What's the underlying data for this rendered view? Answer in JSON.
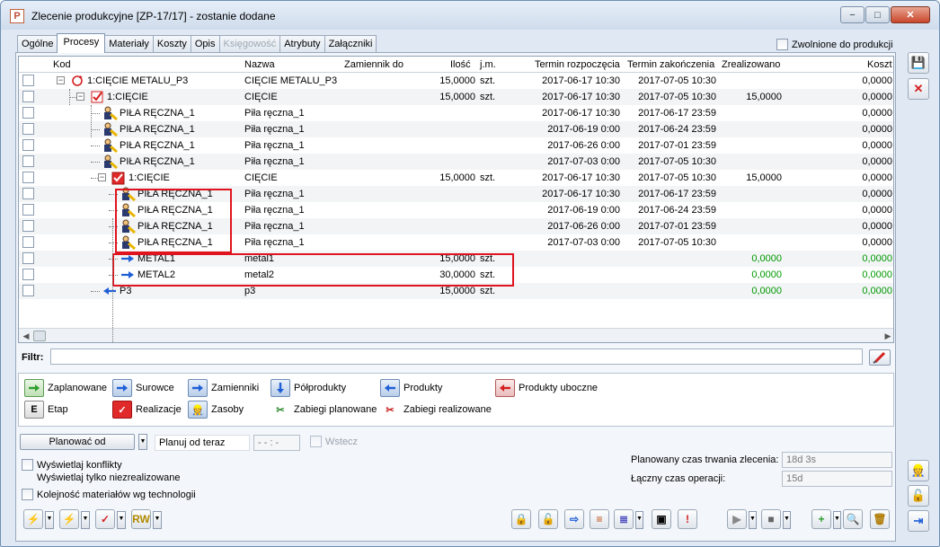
{
  "window": {
    "title": "Zlecenie produkcyjne  [ZP-17/17] - zostanie dodane",
    "app_icon": "P",
    "controls": {
      "minimize": "−",
      "maximize": "□",
      "close": "✕"
    }
  },
  "tabs": [
    {
      "label": "Ogólne",
      "active": false
    },
    {
      "label": "Procesy",
      "active": true
    },
    {
      "label": "Materiały",
      "active": false
    },
    {
      "label": "Koszty",
      "active": false
    },
    {
      "label": "Opis",
      "active": false
    },
    {
      "label": "Księgowość",
      "active": false,
      "disabled": true
    },
    {
      "label": "Atrybuty",
      "active": false
    },
    {
      "label": "Załączniki",
      "active": false
    }
  ],
  "released_label": "Zwolnione do produkcji",
  "columns": {
    "kod": "Kod",
    "nazwa": "Nazwa",
    "zamiennik": "Zamiennik do",
    "ilosc": "Ilość",
    "jm": "j.m.",
    "start": "Termin rozpoczęcia",
    "end": "Termin zakończenia",
    "done": "Zrealizowano",
    "koszt": "Koszt"
  },
  "rows": [
    {
      "kod": "1:CIĘCIE METALU_P3",
      "nazwa": "CIĘCIE METALU_P3",
      "ilosc": "15,0000",
      "jm": "szt.",
      "start": "2017-06-17 10:30",
      "end": "2017-07-05 10:30",
      "done": "",
      "koszt": "0,0000",
      "icon": "process-refresh-icon"
    },
    {
      "kod": "1:CIĘCIE",
      "nazwa": "CIĘCIE",
      "ilosc": "15,0000",
      "jm": "szt.",
      "start": "2017-06-17 10:30",
      "end": "2017-07-05 10:30",
      "done": "15,0000",
      "koszt": "0,0000",
      "icon": "checked-operation-icon"
    },
    {
      "kod": "PIŁA RĘCZNA_1",
      "nazwa": "Piła ręczna_1",
      "ilosc": "",
      "jm": "",
      "start": "2017-06-17 10:30",
      "end": "2017-06-17 23:59",
      "done": "",
      "koszt": "0,0000",
      "icon": "resource-icon"
    },
    {
      "kod": "PIŁA RĘCZNA_1",
      "nazwa": "Piła ręczna_1",
      "ilosc": "",
      "jm": "",
      "start": "2017-06-19 0:00",
      "end": "2017-06-24 23:59",
      "done": "",
      "koszt": "0,0000",
      "icon": "resource-icon"
    },
    {
      "kod": "PIŁA RĘCZNA_1",
      "nazwa": "Piła ręczna_1",
      "ilosc": "",
      "jm": "",
      "start": "2017-06-26 0:00",
      "end": "2017-07-01 23:59",
      "done": "",
      "koszt": "0,0000",
      "icon": "resource-icon"
    },
    {
      "kod": "PIŁA RĘCZNA_1",
      "nazwa": "Piła ręczna_1",
      "ilosc": "",
      "jm": "",
      "start": "2017-07-03 0:00",
      "end": "2017-07-05 10:30",
      "done": "",
      "koszt": "0,0000",
      "icon": "resource-icon"
    },
    {
      "kod": "1:CIĘCIE",
      "nazwa": "CIĘCIE",
      "ilosc": "15,0000",
      "jm": "szt.",
      "start": "2017-06-17 10:30",
      "end": "2017-07-05 10:30",
      "done": "15,0000",
      "koszt": "0,0000",
      "icon": "realized-operation-icon"
    },
    {
      "kod": "PIŁA RĘCZNA_1",
      "nazwa": "Piła ręczna_1",
      "ilosc": "",
      "jm": "",
      "start": "2017-06-17 10:30",
      "end": "2017-06-17 23:59",
      "done": "",
      "koszt": "0,0000",
      "icon": "resource-icon"
    },
    {
      "kod": "PIŁA RĘCZNA_1",
      "nazwa": "Piła ręczna_1",
      "ilosc": "",
      "jm": "",
      "start": "2017-06-19 0:00",
      "end": "2017-06-24 23:59",
      "done": "",
      "koszt": "0,0000",
      "icon": "resource-icon"
    },
    {
      "kod": "PIŁA RĘCZNA_1",
      "nazwa": "Piła ręczna_1",
      "ilosc": "",
      "jm": "",
      "start": "2017-06-26 0:00",
      "end": "2017-07-01 23:59",
      "done": "",
      "koszt": "0,0000",
      "icon": "resource-icon"
    },
    {
      "kod": "PIŁA RĘCZNA_1",
      "nazwa": "Piła ręczna_1",
      "ilosc": "",
      "jm": "",
      "start": "2017-07-03 0:00",
      "end": "2017-07-05 10:30",
      "done": "",
      "koszt": "0,0000",
      "icon": "resource-icon"
    },
    {
      "kod": "METAL1",
      "nazwa": "metal1",
      "ilosc": "15,0000",
      "jm": "szt.",
      "start": "",
      "end": "",
      "done": "0,0000",
      "koszt": "0,0000",
      "icon": "raw-material-arrow-icon",
      "green": true
    },
    {
      "kod": "METAL2",
      "nazwa": "metal2",
      "ilosc": "30,0000",
      "jm": "szt.",
      "start": "",
      "end": "",
      "done": "0,0000",
      "koszt": "0,0000",
      "icon": "raw-material-arrow-icon",
      "green": true
    },
    {
      "kod": "P3",
      "nazwa": "p3",
      "ilosc": "15,0000",
      "jm": "szt.",
      "start": "",
      "end": "",
      "done": "0,0000",
      "koszt": "0,0000",
      "icon": "product-arrow-icon",
      "green": true
    }
  ],
  "filter_label": "Filtr:",
  "legend": [
    {
      "label": "Zaplanowane",
      "icon": "planned-arrow-icon",
      "color": "#2e9e2e"
    },
    {
      "label": "Surowce",
      "icon": "raw-material-arrow-icon",
      "color": "#1f5fd6"
    },
    {
      "label": "Zamienniki",
      "icon": "substitute-arrow-icon",
      "color": "#1f5fd6"
    },
    {
      "label": "Półprodukty",
      "icon": "semi-product-arrow-icon",
      "color": "#1f5fd6"
    },
    {
      "label": "Produkty",
      "icon": "product-arrow-icon",
      "color": "#1f5fd6"
    },
    {
      "label": "Produkty uboczne",
      "icon": "by-product-arrow-icon",
      "color": "#d42020"
    },
    {
      "label": "Etap",
      "icon": "stage-icon",
      "glyph": "E"
    },
    {
      "label": "Realizacje",
      "icon": "realization-icon"
    },
    {
      "label": "Zasoby",
      "icon": "resource-icon"
    },
    {
      "label": "Zabiegi planowane",
      "icon": "planned-treatment-icon"
    },
    {
      "label": "Zabiegi realizowane",
      "icon": "realized-treatment-icon"
    }
  ],
  "plan": {
    "button": "Planować od",
    "mode": "Planuj od teraz",
    "time_placeholder": "- - : -",
    "wstecz": "Wstecz"
  },
  "options": [
    "Wyświetlaj konflikty",
    "Wyświetlaj tylko niezrealizowane",
    "Kolejność materiałów wg technologii"
  ],
  "duration": {
    "planned_label": "Planowany czas trwania zlecenia:",
    "planned_value": "18d 3s",
    "total_label": "Łączny czas operacji:",
    "total_value": "15d"
  },
  "toolbar_left": [
    {
      "glyph": "⚡",
      "icon": "lightning-orange-icon"
    },
    {
      "glyph": "⚡",
      "icon": "lightning-green-icon"
    },
    {
      "glyph": "✓",
      "icon": "realization-checked-icon"
    },
    {
      "glyph": "RW",
      "icon": "rw-document-icon"
    }
  ],
  "toolbar_right": [
    {
      "glyph": "🔒",
      "icon": "lock-icon"
    },
    {
      "glyph": "🔓",
      "icon": "unlock-icon"
    },
    {
      "glyph": "⇨",
      "icon": "export-icon"
    },
    {
      "glyph": "≡",
      "icon": "gantt-icon"
    },
    {
      "glyph": "≣",
      "icon": "gantt-list-icon"
    },
    {
      "glyph": "▣",
      "icon": "copy-icon"
    },
    {
      "glyph": "!",
      "icon": "alert-document-icon"
    },
    {
      "glyph": "▶",
      "icon": "play-icon"
    },
    {
      "glyph": "■",
      "icon": "stop-icon"
    },
    {
      "glyph": "+",
      "icon": "add-icon"
    },
    {
      "glyph": "🔍",
      "icon": "search-icon"
    },
    {
      "glyph": "🗑",
      "icon": "delete-icon"
    }
  ],
  "colors": {
    "highlight": "#e0141e",
    "green_value": "#009900",
    "accent": "#1f5fd6"
  }
}
